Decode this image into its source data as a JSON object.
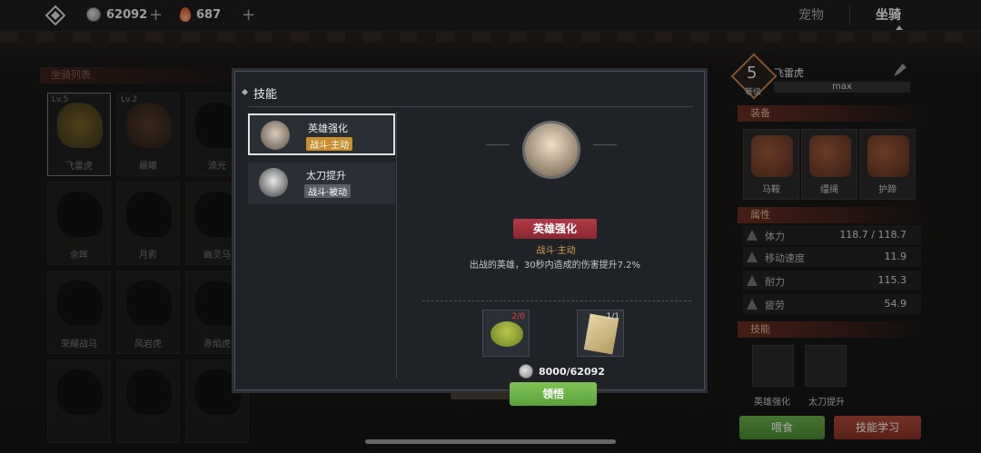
{
  "currency": {
    "coins": "62092",
    "flames": "687"
  },
  "tabs": [
    {
      "label": "宠物"
    },
    {
      "label": "坐骑"
    }
  ],
  "left_panel": {
    "title": "坐骑列表",
    "mounts": [
      {
        "name": "飞雷虎",
        "level": "Lv.5"
      },
      {
        "name": "晨曦",
        "level": "Lv.2"
      },
      {
        "name": "流光",
        "level": ""
      },
      {
        "name": "余晖",
        "level": ""
      },
      {
        "name": "月影",
        "level": ""
      },
      {
        "name": "幽灵马",
        "level": ""
      },
      {
        "name": "荣耀战马",
        "level": ""
      },
      {
        "name": "风岩虎",
        "level": ""
      },
      {
        "name": "赤焰虎",
        "level": ""
      },
      {
        "name": "",
        "level": ""
      },
      {
        "name": "",
        "level": ""
      },
      {
        "name": "",
        "level": ""
      }
    ]
  },
  "right_panel": {
    "level": "5",
    "level_label": "等级",
    "name": "飞雷虎",
    "max_label": "max",
    "equip_title": "装备",
    "equip": [
      {
        "label": "马鞍"
      },
      {
        "label": "缰绳"
      },
      {
        "label": "护蹄"
      }
    ],
    "attr_title": "属性",
    "attrs": [
      {
        "name": "体力",
        "value": "118.7 / 118.7"
      },
      {
        "name": "移动速度",
        "value": "11.9"
      },
      {
        "name": "耐力",
        "value": "115.3"
      },
      {
        "name": "疲劳",
        "value": "54.9"
      }
    ],
    "skill_title": "技能",
    "skills": [
      {
        "label": "英雄强化"
      },
      {
        "label": "太刀提升"
      }
    ],
    "feed_label": "喂食",
    "learn_label": "技能学习"
  },
  "modal": {
    "title": "技能",
    "skills": [
      {
        "name": "英雄强化",
        "tag": "战斗·主动"
      },
      {
        "name": "太刀提升",
        "tag": "战斗·被动"
      }
    ],
    "detail": {
      "name": "英雄强化",
      "type": "战斗·主动",
      "desc": "出战的英雄，30秒内造成的伤害提升7.2%",
      "materials": [
        {
          "count": "2/0"
        },
        {
          "count": "1/1"
        }
      ],
      "cost": "8000/62092",
      "button": "领悟"
    }
  }
}
